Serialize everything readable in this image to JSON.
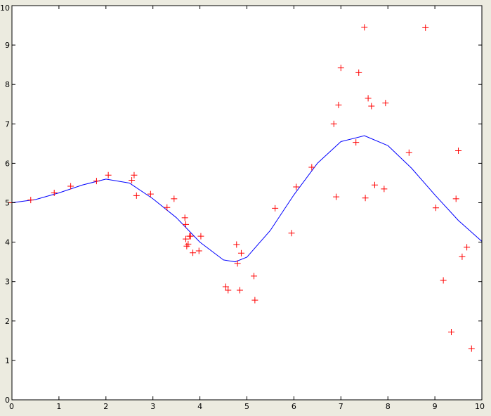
{
  "colors": {
    "figure_background": "#ecebe0",
    "axes_background": "#ffffff",
    "axes_line": "#000000",
    "fit_line": "#0000ff",
    "data_marker": "#ff0000"
  },
  "chart_data": {
    "type": "scatter",
    "title": "",
    "xlabel": "",
    "ylabel": "",
    "xlim": [
      0,
      10
    ],
    "ylim": [
      0,
      10
    ],
    "grid": false,
    "xticks": [
      0,
      1,
      2,
      3,
      4,
      5,
      6,
      7,
      8,
      9,
      10
    ],
    "yticks": [
      0,
      1,
      2,
      3,
      4,
      5,
      6,
      7,
      8,
      9,
      10
    ],
    "series": [
      {
        "kind": "markers",
        "marker": "+",
        "color": "#ff0000",
        "points": [
          [
            0.0,
            5.0
          ],
          [
            0.4,
            5.07
          ],
          [
            0.9,
            5.25
          ],
          [
            1.25,
            5.42
          ],
          [
            1.8,
            5.55
          ],
          [
            2.05,
            5.7
          ],
          [
            2.55,
            5.57
          ],
          [
            2.6,
            5.7
          ],
          [
            2.65,
            5.18
          ],
          [
            2.95,
            5.22
          ],
          [
            3.3,
            4.88
          ],
          [
            3.45,
            5.1
          ],
          [
            3.68,
            4.62
          ],
          [
            3.7,
            4.45
          ],
          [
            3.7,
            4.08
          ],
          [
            3.72,
            3.9
          ],
          [
            3.75,
            3.95
          ],
          [
            3.78,
            4.15
          ],
          [
            3.8,
            4.15
          ],
          [
            3.85,
            3.73
          ],
          [
            3.98,
            3.78
          ],
          [
            4.02,
            4.15
          ],
          [
            4.55,
            2.87
          ],
          [
            4.6,
            2.78
          ],
          [
            4.78,
            3.94
          ],
          [
            4.8,
            3.46
          ],
          [
            4.85,
            2.78
          ],
          [
            4.88,
            3.72
          ],
          [
            5.15,
            3.14
          ],
          [
            5.17,
            2.53
          ],
          [
            5.6,
            4.86
          ],
          [
            5.95,
            4.23
          ],
          [
            6.05,
            5.4
          ],
          [
            6.38,
            5.9
          ],
          [
            6.85,
            7.0
          ],
          [
            6.9,
            5.15
          ],
          [
            6.95,
            7.48
          ],
          [
            7.0,
            8.42
          ],
          [
            7.32,
            6.53
          ],
          [
            7.38,
            8.3
          ],
          [
            7.5,
            9.45
          ],
          [
            7.52,
            5.12
          ],
          [
            7.58,
            7.65
          ],
          [
            7.65,
            7.45
          ],
          [
            7.72,
            5.45
          ],
          [
            7.92,
            5.35
          ],
          [
            7.95,
            7.53
          ],
          [
            8.45,
            6.27
          ],
          [
            8.8,
            9.44
          ],
          [
            9.02,
            4.87
          ],
          [
            9.18,
            3.03
          ],
          [
            9.35,
            1.72
          ],
          [
            9.45,
            5.1
          ],
          [
            9.5,
            6.32
          ],
          [
            9.58,
            3.63
          ],
          [
            9.68,
            3.87
          ],
          [
            9.78,
            1.3
          ]
        ]
      },
      {
        "kind": "line",
        "color": "#0000ff",
        "points": [
          [
            0.0,
            5.0
          ],
          [
            0.5,
            5.08
          ],
          [
            1.0,
            5.25
          ],
          [
            1.5,
            5.45
          ],
          [
            2.0,
            5.6
          ],
          [
            2.5,
            5.5
          ],
          [
            3.0,
            5.1
          ],
          [
            3.5,
            4.62
          ],
          [
            4.0,
            4.0
          ],
          [
            4.5,
            3.55
          ],
          [
            4.75,
            3.5
          ],
          [
            5.0,
            3.62
          ],
          [
            5.5,
            4.3
          ],
          [
            6.0,
            5.2
          ],
          [
            6.5,
            6.0
          ],
          [
            7.0,
            6.55
          ],
          [
            7.5,
            6.7
          ],
          [
            8.0,
            6.45
          ],
          [
            8.5,
            5.88
          ],
          [
            9.0,
            5.2
          ],
          [
            9.5,
            4.55
          ],
          [
            10.0,
            4.02
          ]
        ]
      }
    ]
  }
}
